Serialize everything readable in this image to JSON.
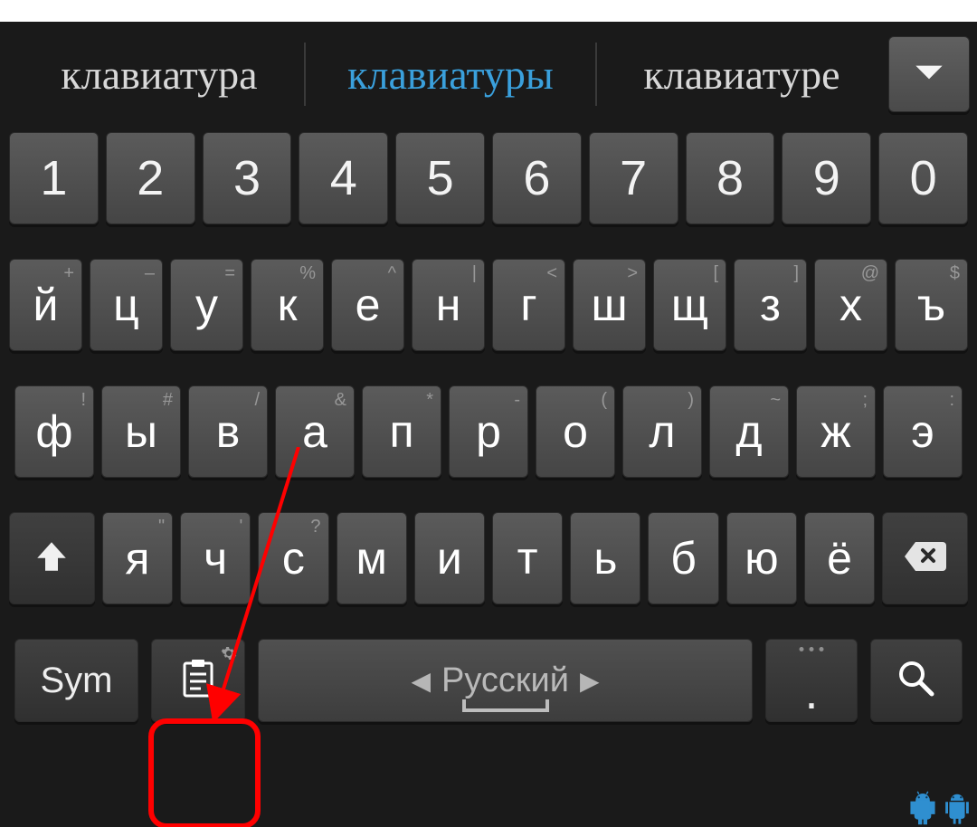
{
  "suggestions": {
    "left": "клавиатура",
    "mid": "клавиатуры",
    "right": "клавиатуре"
  },
  "rows": {
    "num": [
      "1",
      "2",
      "3",
      "4",
      "5",
      "6",
      "7",
      "8",
      "9",
      "0"
    ],
    "r1": [
      {
        "m": "й",
        "h": "+"
      },
      {
        "m": "ц",
        "h": "–"
      },
      {
        "m": "у",
        "h": "="
      },
      {
        "m": "к",
        "h": "%"
      },
      {
        "m": "е",
        "h": "^"
      },
      {
        "m": "н",
        "h": "|"
      },
      {
        "m": "г",
        "h": "<"
      },
      {
        "m": "ш",
        "h": ">"
      },
      {
        "m": "щ",
        "h": "["
      },
      {
        "m": "з",
        "h": "]"
      },
      {
        "m": "х",
        "h": "@"
      },
      {
        "m": "ъ",
        "h": "$"
      }
    ],
    "r2": [
      {
        "m": "ф",
        "h": "!"
      },
      {
        "m": "ы",
        "h": "#"
      },
      {
        "m": "в",
        "h": "/"
      },
      {
        "m": "а",
        "h": "&"
      },
      {
        "m": "п",
        "h": "*"
      },
      {
        "m": "р",
        "h": "-"
      },
      {
        "m": "о",
        "h": "("
      },
      {
        "m": "л",
        "h": ")"
      },
      {
        "m": "д",
        "h": "~"
      },
      {
        "m": "ж",
        "h": ";"
      },
      {
        "m": "э",
        "h": ":"
      }
    ],
    "r3": [
      {
        "m": "я",
        "h": "\""
      },
      {
        "m": "ч",
        "h": "'"
      },
      {
        "m": "с",
        "h": "?"
      },
      {
        "m": "м",
        "h": ""
      },
      {
        "m": "и",
        "h": ""
      },
      {
        "m": "т",
        "h": ""
      },
      {
        "m": "ь",
        "h": ""
      },
      {
        "m": "б",
        "h": ""
      },
      {
        "m": "ю",
        "h": ""
      },
      {
        "m": "ё",
        "h": ""
      }
    ]
  },
  "bottom": {
    "sym": "Sym",
    "language": "Русский",
    "period": "."
  }
}
